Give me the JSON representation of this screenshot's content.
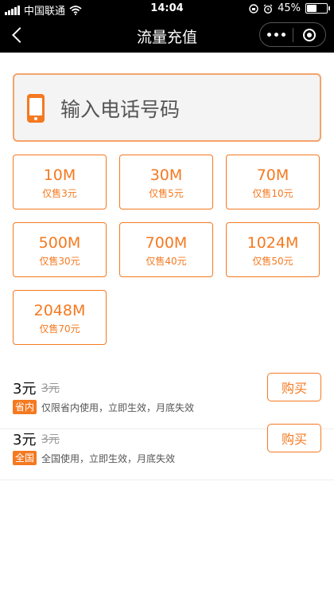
{
  "status_bar": {
    "carrier": "中国联通",
    "time": "14:04",
    "battery_level": 0.45,
    "battery_text": "45%",
    "icons": [
      "signal-icon",
      "wifi-icon",
      "rotation-lock-icon",
      "alarm-icon",
      "battery-icon"
    ]
  },
  "nav": {
    "title": "流量充值",
    "icons": [
      "back-icon",
      "more-icon",
      "close-mini-program-icon"
    ]
  },
  "phone": {
    "placeholder": "输入电话号码",
    "value": "",
    "icon": "mobile-phone-icon"
  },
  "packages": [
    {
      "size": "10M",
      "price": "仅售3元"
    },
    {
      "size": "30M",
      "price": "仅售5元"
    },
    {
      "size": "70M",
      "price": "仅售10元"
    },
    {
      "size": "500M",
      "price": "仅售30元"
    },
    {
      "size": "700M",
      "price": "仅售40元"
    },
    {
      "size": "1024M",
      "price": "仅售50元"
    },
    {
      "size": "2048M",
      "price": "仅售70元"
    }
  ],
  "products": [
    {
      "price": "3元",
      "original_price": "3元",
      "tag": "省内",
      "desc": "仅限省内使用，立即生效，月底失效",
      "button": "购买"
    },
    {
      "price": "3元",
      "original_price": "3元",
      "tag": "全国",
      "desc": "全国使用，立即生效，月底失效",
      "button": "购买"
    }
  ],
  "colors": {
    "accent": "#f47920",
    "bar": "#000000",
    "input_bg": "#f4f4f4"
  }
}
